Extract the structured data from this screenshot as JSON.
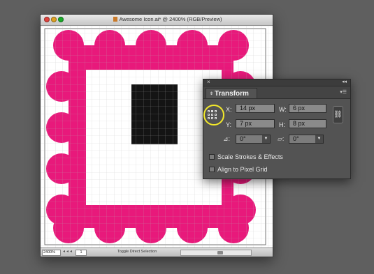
{
  "document": {
    "title": "Awesome Icon.ai* @ 2400% (RGB/Preview)",
    "zoom": "2400%",
    "page": "1",
    "status": "Toggle Direct Selection"
  },
  "colors": {
    "magenta": "#e8197b",
    "black_square": "#141414",
    "panel_bg": "#535353",
    "highlight": "#f3e92a"
  },
  "transform_panel": {
    "tab_label": "Transform",
    "x_label": "X:",
    "x_value": "14 px",
    "y_label": "Y:",
    "y_value": "7 px",
    "w_label": "W:",
    "w_value": "6 px",
    "h_label": "H:",
    "h_value": "8 px",
    "rotate_value": "0°",
    "shear_value": "0°",
    "scale_strokes_label": "Scale Strokes & Effects",
    "align_pixel_label": "Align to Pixel Grid",
    "icons": [
      "close-icon",
      "collapse-icon",
      "panel-menu-icon",
      "reference-point-icon",
      "link-proportions-icon",
      "rotate-icon",
      "shear-icon"
    ]
  }
}
